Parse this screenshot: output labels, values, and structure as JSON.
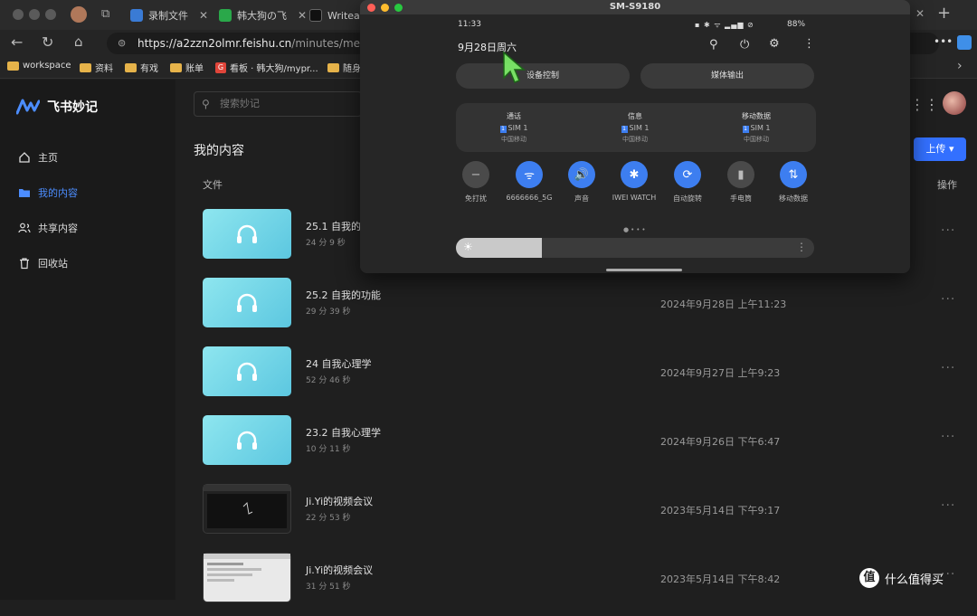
{
  "browser": {
    "tabs": [
      {
        "label": "录制文件",
        "color": "#3a7bd5"
      },
      {
        "label": "韩大狗の飞",
        "color": "#2aa84a"
      },
      {
        "label": "Writeat",
        "color": "#111111"
      }
    ],
    "new_tab": "+",
    "url_host": "https://a2zzn2olmr.feishu.cn",
    "url_path": "/minutes/me",
    "bookmarks": [
      "workspace",
      "资料",
      "有戏",
      "账单",
      "看板 · 韩大狗/mypr...",
      "随身"
    ]
  },
  "app": {
    "name": "飞书妙记",
    "search_placeholder": "搜索妙记",
    "nav": [
      {
        "label": "主页",
        "icon": "home-icon"
      },
      {
        "label": "我的内容",
        "icon": "folder-icon",
        "active": true
      },
      {
        "label": "共享内容",
        "icon": "users-icon"
      },
      {
        "label": "回收站",
        "icon": "trash-icon"
      }
    ],
    "page_title": "我的内容",
    "col_file": "文件",
    "col_ops": "操作",
    "upload": "上传 ▾",
    "rows": [
      {
        "title": "25.1 自我的",
        "duration": "24 分 9 秒",
        "date": "",
        "type": "audio"
      },
      {
        "title": "25.2 自我的功能",
        "duration": "29 分 39 秒",
        "date": "2024年9月28日 上午11:23",
        "type": "audio"
      },
      {
        "title": "24 自我心理学",
        "duration": "52 分 46 秒",
        "date": "2024年9月27日 上午9:23",
        "type": "audio"
      },
      {
        "title": "23.2 自我心理学",
        "duration": "10 分 11 秒",
        "date": "2024年9月26日 下午6:47",
        "type": "audio"
      },
      {
        "title": "Ji.Yi的视频会议",
        "duration": "22 分 53 秒",
        "date": "2023年5月14日 下午9:17",
        "type": "video-dark"
      },
      {
        "title": "Ji.Yi的视频会议",
        "duration": "31 分 51 秒",
        "date": "2023年5月14日 下午8:42",
        "type": "video-light"
      }
    ]
  },
  "phone": {
    "window_title": "SM-S9180",
    "time": "11:33",
    "date": "9月28日周六",
    "battery": "88%",
    "btn_device": "设备控制",
    "btn_media": "媒体输出",
    "sims": [
      {
        "title": "通话",
        "sim": "SIM 1",
        "carrier": "中国移动"
      },
      {
        "title": "信息",
        "sim": "SIM 1",
        "carrier": "中国移动"
      },
      {
        "title": "移动数据",
        "sim": "SIM 1",
        "carrier": "中国移动"
      }
    ],
    "tiles": [
      {
        "label": "免打扰",
        "icon": "minus",
        "on": false
      },
      {
        "label": "6666666_5G",
        "icon": "wifi",
        "on": true
      },
      {
        "label": "声音",
        "icon": "sound",
        "on": true
      },
      {
        "label": "IWEI WATCH",
        "icon": "bluetooth",
        "on": true
      },
      {
        "label": "自动旋转",
        "icon": "rotate",
        "on": true
      },
      {
        "label": "手电筒",
        "icon": "flashlight",
        "on": false
      },
      {
        "label": "移动数据",
        "icon": "data",
        "on": true
      }
    ],
    "brightness": 0.24
  },
  "watermark": {
    "text": "什么值得买",
    "logo": "值"
  }
}
